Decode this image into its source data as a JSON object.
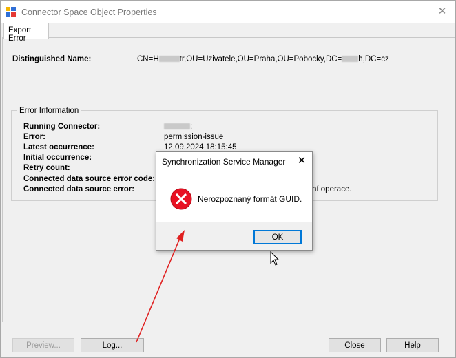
{
  "window": {
    "title": "Connector Space Object Properties",
    "close_glyph": "✕",
    "icon": "app-window-icon"
  },
  "tabs": [
    {
      "label": "Export Error",
      "selected": true
    }
  ],
  "distinguished_name": {
    "label": "Distinguished Name:",
    "value_prefix": "CN=H",
    "value_mid1": "tr,OU=Uzivatele,OU=Praha,OU=Pobocky,DC=",
    "value_mid2": "h,DC=cz"
  },
  "error_information": {
    "group_title": "Error Information",
    "running_connector": {
      "label": "Running Connector:",
      "value_suffix": ":"
    },
    "error": {
      "label": "Error:",
      "value": "permission-issue"
    },
    "latest_occurrence": {
      "label": "Latest occurrence:",
      "value": "12.09.2024 18:15:45"
    },
    "initial_occurrence": {
      "label": "Initial occurrence:"
    },
    "retry_count": {
      "label": "Retry count:"
    },
    "cds_error_code": {
      "label": "Connected data source error code:"
    },
    "cds_error": {
      "label": "Connected data source error:",
      "value_tail": "ní operace."
    }
  },
  "buttons": {
    "preview": "Preview...",
    "log": "Log...",
    "close": "Close",
    "help": "Help"
  },
  "dialog": {
    "title": "Synchronization Service Manager",
    "close_glyph": "✕",
    "message": "Nerozpoznaný formát GUID.",
    "ok": "OK",
    "icon": "error-icon"
  },
  "colors": {
    "error_red": "#e81123",
    "annotation_arrow": "#e02020",
    "focus_blue": "#0078d7"
  }
}
